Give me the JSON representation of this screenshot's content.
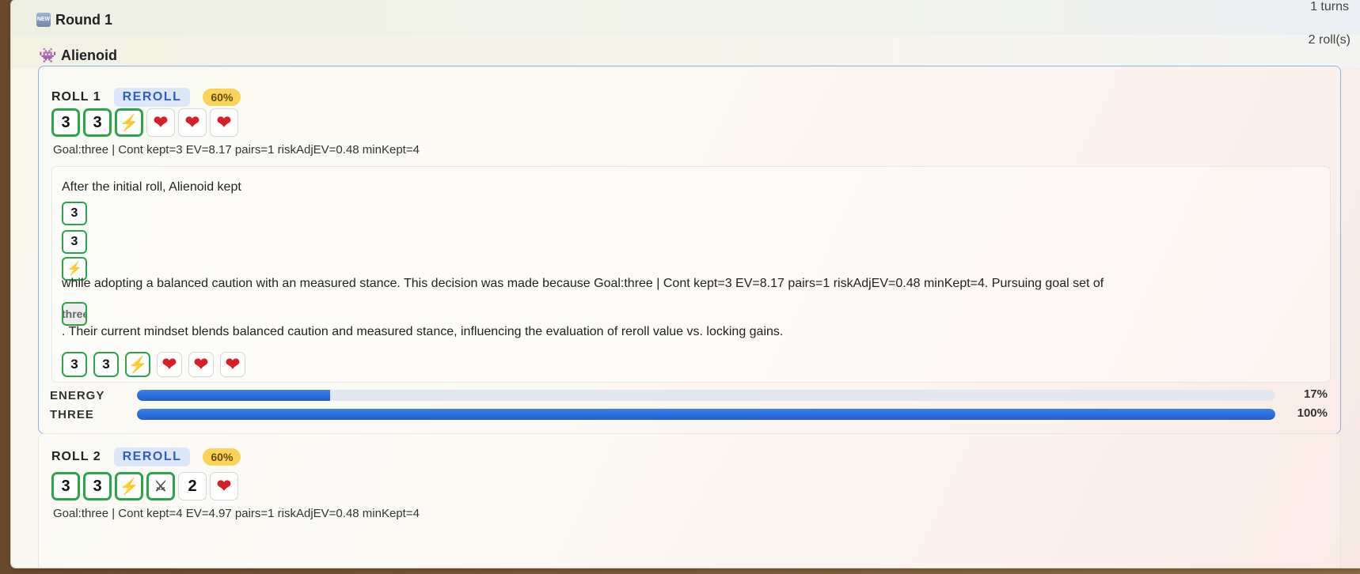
{
  "round": {
    "icon": "new-badge-icon",
    "icon_text": "NEW",
    "title": "Round 1",
    "turns": "1 turns"
  },
  "player": {
    "icon": "alien-monster-icon",
    "name": "Alienoid",
    "rolls": "2 roll(s)"
  },
  "rolls": [
    {
      "label": "ROLL 1",
      "action": "REROLL",
      "percent": "60%",
      "dice": [
        {
          "face": "3",
          "kept": true
        },
        {
          "face": "3",
          "kept": true
        },
        {
          "face": "energy",
          "kept": true
        },
        {
          "face": "heart",
          "kept": false
        },
        {
          "face": "heart",
          "kept": false
        },
        {
          "face": "heart",
          "kept": false
        }
      ],
      "stats": "Goal:three | Cont kept=3 EV=8.17 pairs=1 riskAdjEV=0.48 minKept=4",
      "narrative": {
        "intro": "After the initial roll, Alienoid kept",
        "kept": [
          "3",
          "3",
          "⚡"
        ],
        "middle": "while adopting a balanced caution with an measured stance. This decision was made because Goal:three | Cont kept=3 EV=8.17 pairs=1 riskAdjEV=0.48 minKept=4. Pursuing goal set of",
        "goal_chip": "three",
        "end": ". Their current mindset blends balanced caution and measured stance, influencing the evaluation of reroll value vs. locking gains."
      },
      "meters": [
        {
          "label": "ENERGY",
          "value": "17%",
          "fraction": 0.17
        },
        {
          "label": "THREE",
          "value": "100%",
          "fraction": 1.0
        }
      ]
    },
    {
      "label": "ROLL 2",
      "action": "REROLL",
      "percent": "60%",
      "dice": [
        {
          "face": "3",
          "kept": true
        },
        {
          "face": "3",
          "kept": true
        },
        {
          "face": "energy",
          "kept": true
        },
        {
          "face": "claw",
          "kept": true
        },
        {
          "face": "2",
          "kept": false
        },
        {
          "face": "heart",
          "kept": false
        }
      ],
      "stats": "Goal:three | Cont kept=4 EV=4.97 pairs=1 riskAdjEV=0.48 minKept=4"
    }
  ],
  "glyphs": {
    "energy": "⚡",
    "heart": "❤",
    "claw": "⚔"
  },
  "colors": {
    "kept_border": "#2ba44a",
    "reroll_text": "#2c5fc4",
    "percent_bg": "#fbd25a",
    "meter_fill": "#2a6fe0"
  }
}
